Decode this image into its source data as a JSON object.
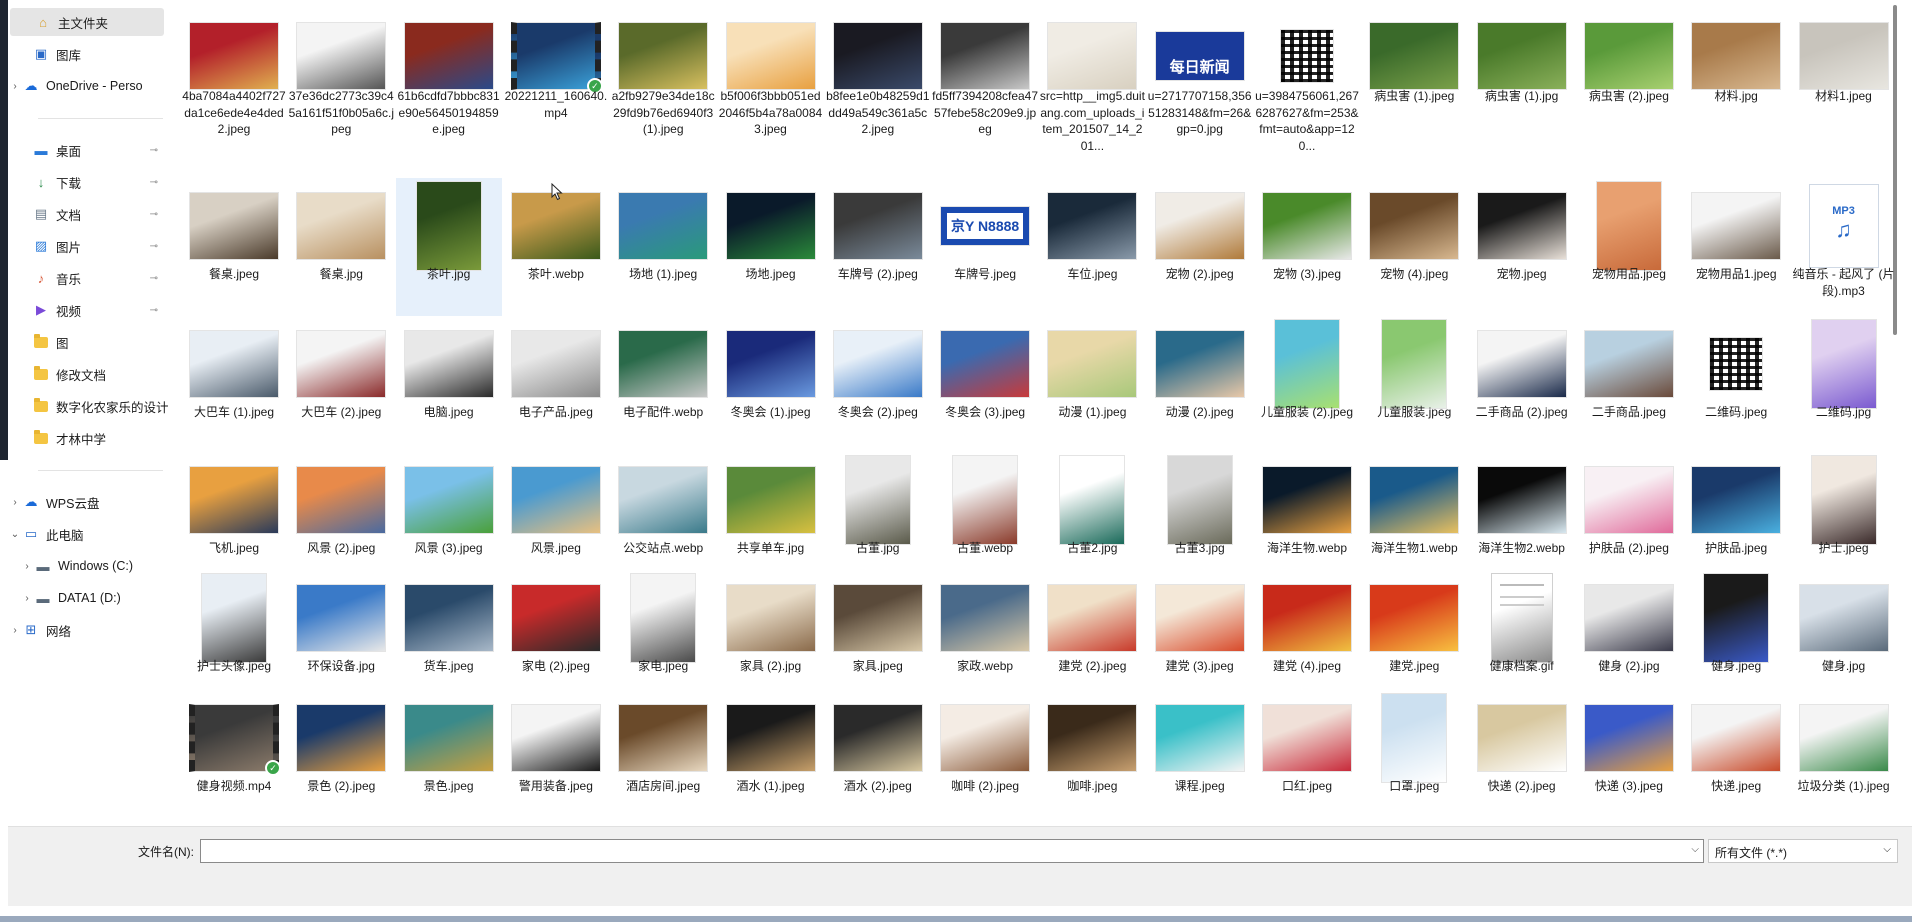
{
  "sidebar": {
    "items": [
      {
        "label": "主文件夹",
        "icon": "home-icon",
        "selected": true
      },
      {
        "label": "图库",
        "icon": "gallery-icon"
      },
      {
        "label": "OneDrive - Perso",
        "icon": "cloud-icon",
        "expandable": true
      },
      {
        "label": "桌面",
        "icon": "desktop-icon",
        "pinned": true
      },
      {
        "label": "下载",
        "icon": "download-icon",
        "pinned": true
      },
      {
        "label": "文档",
        "icon": "document-icon",
        "pinned": true
      },
      {
        "label": "图片",
        "icon": "pictures-icon",
        "pinned": true
      },
      {
        "label": "音乐",
        "icon": "music-icon",
        "pinned": true
      },
      {
        "label": "视频",
        "icon": "video-icon",
        "pinned": true
      },
      {
        "label": "图",
        "icon": "folder-icon"
      },
      {
        "label": "修改文档",
        "icon": "folder-icon"
      },
      {
        "label": "数字化农家乐的设计",
        "icon": "folder-icon"
      },
      {
        "label": "才林中学",
        "icon": "folder-icon"
      },
      {
        "label": "WPS云盘",
        "icon": "cloud-icon",
        "expandable": true
      },
      {
        "label": "此电脑",
        "icon": "computer-icon",
        "expanded": true
      },
      {
        "label": "Windows (C:)",
        "icon": "drive-icon",
        "expandable": true
      },
      {
        "label": "DATA1 (D:)",
        "icon": "drive-icon",
        "expandable": true
      },
      {
        "label": "网络",
        "icon": "network-icon",
        "expandable": true
      }
    ]
  },
  "files": [
    {
      "name": "4ba7084a4402f727da1ce6ede4e4ded2.jpeg",
      "c": [
        "#b3202a",
        "#e0b050"
      ]
    },
    {
      "name": "37e36dc2773c39c45a161f51f0b05a6c.jpeg",
      "c": [
        "#f4f4f4",
        "#555555"
      ]
    },
    {
      "name": "61b6cdfd7bbbc831e90e56450194859e.jpeg",
      "c": [
        "#8a2a1e",
        "#2a4a8a"
      ]
    },
    {
      "name": "20221211_160640.mp4",
      "c": [
        "#1a3a6a",
        "#3aa0d8"
      ],
      "video": true
    },
    {
      "name": "a2fb9279e34de18c29fd9b76ed6940f3(1).jpeg",
      "c": [
        "#5a6a2a",
        "#d8c060"
      ]
    },
    {
      "name": "b5f006f3bbb051ed2046f5b4a78a00843.jpeg",
      "c": [
        "#f8e0b8",
        "#e8a040"
      ]
    },
    {
      "name": "b8fee1e0b48259d1dd49a549c361a5c2.jpeg",
      "c": [
        "#1a1a22",
        "#3a4a6a"
      ]
    },
    {
      "name": "fd5ff7394208cfea4757febe58c209e9.jpeg",
      "c": [
        "#3a3a3a",
        "#c8c8c8"
      ]
    },
    {
      "name": "src=http__img5.duitang.com_uploads_item_201507_14_201...",
      "c": [
        "#f0ece4",
        "#d8d0c0"
      ]
    },
    {
      "name": "u=2717707158,35651283148&fm=26&gp=0.jpg",
      "c": [
        "#1a3a9a",
        "#1a3a9a"
      ],
      "banner": "每日新闻"
    },
    {
      "name": "u=3984756061,2676287627&fm=253&fmt=auto&app=120...",
      "c": [
        "#ffffff",
        "#222222"
      ],
      "qr": true
    },
    {
      "name": "病虫害 (1).jpeg",
      "c": [
        "#3a6a2a",
        "#7aa04a"
      ]
    },
    {
      "name": "病虫害 (1).jpg",
      "c": [
        "#4a7a2a",
        "#8ab05a"
      ]
    },
    {
      "name": "病虫害 (2).jpeg",
      "c": [
        "#5a9a3a",
        "#a8d070"
      ]
    },
    {
      "name": "材料.jpg",
      "c": [
        "#a87a4a",
        "#d8b890"
      ]
    },
    {
      "name": "材料1.jpeg",
      "c": [
        "#c8c4bc",
        "#e8e6e0"
      ]
    },
    {
      "name": "餐桌.jpeg",
      "c": [
        "#d8d0c4",
        "#4a3a2a"
      ]
    },
    {
      "name": "餐桌.jpg",
      "c": [
        "#e8dcc8",
        "#b89060"
      ]
    },
    {
      "name": "茶叶.jpg",
      "c": [
        "#2a4a1a",
        "#7a9a3a"
      ],
      "tall": true,
      "selected": true
    },
    {
      "name": "茶叶.webp",
      "c": [
        "#c89a4a",
        "#3a5a1a"
      ]
    },
    {
      "name": "场地 (1).jpeg",
      "c": [
        "#3a7ab0",
        "#2a9a7a"
      ]
    },
    {
      "name": "场地.jpeg",
      "c": [
        "#0a1a2a",
        "#2a8a3a"
      ]
    },
    {
      "name": "车牌号 (2).jpeg",
      "c": [
        "#3a3a3a",
        "#7a8a9a"
      ]
    },
    {
      "name": "车牌号.jpeg",
      "c": [
        "#ffffff",
        "#1a4ab0"
      ],
      "plate": "京Y N8888"
    },
    {
      "name": "车位.jpeg",
      "c": [
        "#1a2a3a",
        "#8a9aaa"
      ]
    },
    {
      "name": "宠物 (2).jpeg",
      "c": [
        "#f0ece6",
        "#b07a3a"
      ]
    },
    {
      "name": "宠物 (3).jpeg",
      "c": [
        "#4a8a2a",
        "#e8e8e8"
      ]
    },
    {
      "name": "宠物 (4).jpeg",
      "c": [
        "#6a4a2a",
        "#d8b890"
      ]
    },
    {
      "name": "宠物.jpeg",
      "c": [
        "#1a1a1a",
        "#e8e0d8"
      ]
    },
    {
      "name": "宠物用品.jpeg",
      "c": [
        "#e8a070",
        "#c86a3a"
      ],
      "tall": true
    },
    {
      "name": "宠物用品1.jpeg",
      "c": [
        "#f4f4f4",
        "#6a5a4a"
      ]
    },
    {
      "name": "纯音乐 - 起风了 (片段).mp3",
      "c": [
        "#ffffff",
        "#2a6ac8"
      ],
      "mp3": true
    },
    {
      "name": "大巴车 (1).jpeg",
      "c": [
        "#e8eef4",
        "#4a5a6a"
      ]
    },
    {
      "name": "大巴车 (2).jpeg",
      "c": [
        "#f4f4f4",
        "#8a2a2a"
      ]
    },
    {
      "name": "电脑.jpeg",
      "c": [
        "#e8e8e8",
        "#2a2a2a"
      ]
    },
    {
      "name": "电子产品.jpeg",
      "c": [
        "#e8e8e8",
        "#8a8a8a"
      ]
    },
    {
      "name": "电子配件.webp",
      "c": [
        "#2a6a4a",
        "#c8c8c8"
      ]
    },
    {
      "name": "冬奥会 (1).jpeg",
      "c": [
        "#1a2a7a",
        "#6a9ae0"
      ]
    },
    {
      "name": "冬奥会 (2).jpeg",
      "c": [
        "#e8f0f8",
        "#3a7ac8"
      ]
    },
    {
      "name": "冬奥会 (3).jpeg",
      "c": [
        "#3a6ab0",
        "#c83a3a"
      ]
    },
    {
      "name": "动漫 (1).jpeg",
      "c": [
        "#e8d8a8",
        "#a8c87a"
      ]
    },
    {
      "name": "动漫 (2).jpeg",
      "c": [
        "#2a6a8a",
        "#e8c8a8"
      ]
    },
    {
      "name": "儿童服装 (2).jpeg",
      "c": [
        "#5ac0d8",
        "#a8e070"
      ],
      "tall": true
    },
    {
      "name": "儿童服装.jpeg",
      "c": [
        "#8ac870",
        "#e8f0e8"
      ],
      "tall": true
    },
    {
      "name": "二手商品 (2).jpeg",
      "c": [
        "#f4f4f4",
        "#1a2a4a"
      ]
    },
    {
      "name": "二手商品.jpeg",
      "c": [
        "#b8d0e0",
        "#6a4a3a"
      ]
    },
    {
      "name": "二维码.jpeg",
      "c": [
        "#ffffff",
        "#222222"
      ],
      "qr": true
    },
    {
      "name": "二维码.jpg",
      "c": [
        "#e0d0f0",
        "#7a5ad0"
      ],
      "tall": true
    },
    {
      "name": "飞机.jpeg",
      "c": [
        "#e8a040",
        "#2a3a5a"
      ]
    },
    {
      "name": "风景 (2).jpeg",
      "c": [
        "#e88a4a",
        "#4a6aa0"
      ]
    },
    {
      "name": "风景 (3).jpeg",
      "c": [
        "#7ac0e8",
        "#4aa03a"
      ]
    },
    {
      "name": "风景.jpeg",
      "c": [
        "#4a9ad0",
        "#e8c080"
      ]
    },
    {
      "name": "公交站点.webp",
      "c": [
        "#c8d8e0",
        "#3a7a8a"
      ]
    },
    {
      "name": "共享单车.jpg",
      "c": [
        "#5a8a3a",
        "#d8c040"
      ]
    },
    {
      "name": "古董.jpg",
      "c": [
        "#e8e8e8",
        "#5a5a4a"
      ],
      "tall": true
    },
    {
      "name": "古董.webp",
      "c": [
        "#f4f4f4",
        "#8a3a2a"
      ],
      "tall": true
    },
    {
      "name": "古董2.jpg",
      "c": [
        "#ffffff",
        "#1a6a5a"
      ],
      "tall": true
    },
    {
      "name": "古董3.jpg",
      "c": [
        "#d8d8d8",
        "#6a6a5a"
      ],
      "tall": true
    },
    {
      "name": "海洋生物.webp",
      "c": [
        "#0a1a2a",
        "#e8a040"
      ]
    },
    {
      "name": "海洋生物1.webp",
      "c": [
        "#1a5a8a",
        "#e8c060"
      ]
    },
    {
      "name": "海洋生物2.webp",
      "c": [
        "#0a0a0a",
        "#d8e8f0"
      ]
    },
    {
      "name": "护肤品 (2).jpeg",
      "c": [
        "#f8f0f4",
        "#e06a9a"
      ]
    },
    {
      "name": "护肤品.jpeg",
      "c": [
        "#1a3a6a",
        "#4ab0e0"
      ]
    },
    {
      "name": "护士.jpeg",
      "c": [
        "#f0e8e0",
        "#3a2a2a"
      ],
      "tall": true
    },
    {
      "name": "护士头像.jpeg",
      "c": [
        "#e8eef4",
        "#3a3a3a"
      ],
      "tall": true
    },
    {
      "name": "环保设备.jpg",
      "c": [
        "#3a7ac8",
        "#e8e8e8"
      ]
    },
    {
      "name": "货车.jpeg",
      "c": [
        "#2a4a6a",
        "#a8b8c8"
      ]
    },
    {
      "name": "家电 (2).jpeg",
      "c": [
        "#c82a2a",
        "#2a2a2a"
      ]
    },
    {
      "name": "家电.jpeg",
      "c": [
        "#f4f4f4",
        "#4a4a4a"
      ],
      "tall": true
    },
    {
      "name": "家具 (2).jpg",
      "c": [
        "#e8dcc8",
        "#8a6a4a"
      ]
    },
    {
      "name": "家具.jpeg",
      "c": [
        "#5a4a3a",
        "#d8c8a8"
      ]
    },
    {
      "name": "家政.webp",
      "c": [
        "#4a6a8a",
        "#d8c8a8"
      ]
    },
    {
      "name": "建党 (2).jpeg",
      "c": [
        "#f0e0c8",
        "#c83a2a"
      ]
    },
    {
      "name": "建党 (3).jpeg",
      "c": [
        "#f4e8d8",
        "#d84a2a"
      ]
    },
    {
      "name": "建党 (4).jpeg",
      "c": [
        "#c82a1a",
        "#f0c040"
      ]
    },
    {
      "name": "建党.jpeg",
      "c": [
        "#d83a1a",
        "#f8c040"
      ]
    },
    {
      "name": "健康档案.gif",
      "c": [
        "#ffffff",
        "#8a8a8a"
      ],
      "doc": true
    },
    {
      "name": "健身 (2).jpg",
      "c": [
        "#e8e8e8",
        "#3a3a4a"
      ]
    },
    {
      "name": "健身.jpeg",
      "c": [
        "#1a1a1a",
        "#3a5ac8"
      ],
      "tall": true
    },
    {
      "name": "健身.jpg",
      "c": [
        "#d8e0e8",
        "#5a6a7a"
      ]
    },
    {
      "name": "健身视频.mp4",
      "c": [
        "#3a3a3a",
        "#8a7a6a"
      ],
      "video": true
    },
    {
      "name": "景色 (2).jpeg",
      "c": [
        "#1a3a6a",
        "#e8a040"
      ]
    },
    {
      "name": "景色.jpeg",
      "c": [
        "#3a8a8a",
        "#c8a040"
      ]
    },
    {
      "name": "警用装备.jpeg",
      "c": [
        "#f4f4f4",
        "#1a1a1a"
      ]
    },
    {
      "name": "酒店房间.jpeg",
      "c": [
        "#6a4a2a",
        "#e8d8c0"
      ]
    },
    {
      "name": "酒水 (1).jpeg",
      "c": [
        "#1a1a1a",
        "#c8a06a"
      ]
    },
    {
      "name": "酒水 (2).jpeg",
      "c": [
        "#2a2a2a",
        "#d8c8a0"
      ]
    },
    {
      "name": "咖啡 (2).jpeg",
      "c": [
        "#f4ece4",
        "#8a5a3a"
      ]
    },
    {
      "name": "咖啡.jpeg",
      "c": [
        "#3a2a1a",
        "#c8a070"
      ]
    },
    {
      "name": "课程.jpeg",
      "c": [
        "#3ac0c8",
        "#f4f4f4"
      ]
    },
    {
      "name": "口红.jpeg",
      "c": [
        "#f0e0d8",
        "#c82a3a"
      ]
    },
    {
      "name": "口罩.jpeg",
      "c": [
        "#cce0f0",
        "#ffffff"
      ],
      "tall": true
    },
    {
      "name": "快递 (2).jpeg",
      "c": [
        "#d8c8a0",
        "#ffffff"
      ]
    },
    {
      "name": "快递 (3).jpeg",
      "c": [
        "#3a5ac8",
        "#e8a040"
      ]
    },
    {
      "name": "快递.jpeg",
      "c": [
        "#f4f4f4",
        "#c84a2a"
      ]
    },
    {
      "name": "垃圾分类 (1).jpeg",
      "c": [
        "#f4f4f4",
        "#3a8a4a"
      ]
    }
  ],
  "bottom": {
    "filename_label": "文件名(N):",
    "filename_value": "",
    "filetype": "所有文件 (*.*)"
  }
}
